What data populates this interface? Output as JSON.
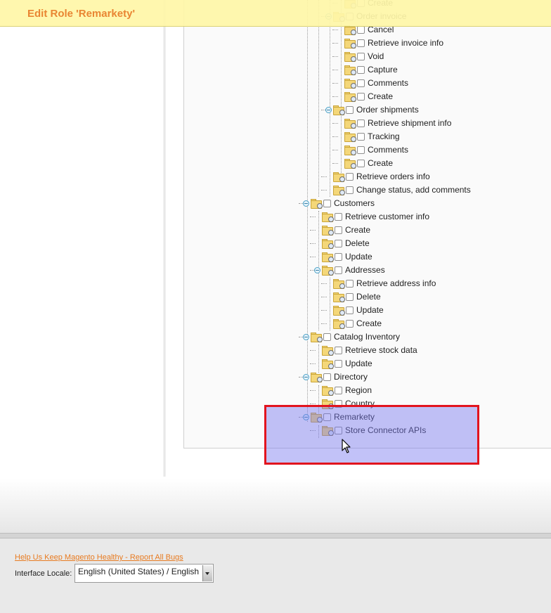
{
  "header": {
    "title": "Edit Role 'Remarkety'"
  },
  "tree": [
    {
      "label": "Create",
      "depth": 3,
      "toggle": false
    },
    {
      "label": "Order invoice",
      "depth": 2,
      "toggle": true
    },
    {
      "label": "Cancel",
      "depth": 3,
      "toggle": false
    },
    {
      "label": "Retrieve invoice info",
      "depth": 3,
      "toggle": false
    },
    {
      "label": "Void",
      "depth": 3,
      "toggle": false
    },
    {
      "label": "Capture",
      "depth": 3,
      "toggle": false
    },
    {
      "label": "Comments",
      "depth": 3,
      "toggle": false
    },
    {
      "label": "Create",
      "depth": 3,
      "toggle": false
    },
    {
      "label": "Order shipments",
      "depth": 2,
      "toggle": true
    },
    {
      "label": "Retrieve shipment info",
      "depth": 3,
      "toggle": false
    },
    {
      "label": "Tracking",
      "depth": 3,
      "toggle": false
    },
    {
      "label": "Comments",
      "depth": 3,
      "toggle": false
    },
    {
      "label": "Create",
      "depth": 3,
      "toggle": false
    },
    {
      "label": "Retrieve orders info",
      "depth": 2,
      "toggle": false
    },
    {
      "label": "Change status, add comments",
      "depth": 2,
      "toggle": false
    },
    {
      "label": "Customers",
      "depth": 0,
      "toggle": true
    },
    {
      "label": "Retrieve customer info",
      "depth": 1,
      "toggle": false
    },
    {
      "label": "Create",
      "depth": 1,
      "toggle": false
    },
    {
      "label": "Delete",
      "depth": 1,
      "toggle": false
    },
    {
      "label": "Update",
      "depth": 1,
      "toggle": false
    },
    {
      "label": "Addresses",
      "depth": 1,
      "toggle": true
    },
    {
      "label": "Retrieve address info",
      "depth": 2,
      "toggle": false
    },
    {
      "label": "Delete",
      "depth": 2,
      "toggle": false
    },
    {
      "label": "Update",
      "depth": 2,
      "toggle": false
    },
    {
      "label": "Create",
      "depth": 2,
      "toggle": false
    },
    {
      "label": "Catalog Inventory",
      "depth": 0,
      "toggle": true
    },
    {
      "label": "Retrieve stock data",
      "depth": 1,
      "toggle": false
    },
    {
      "label": "Update",
      "depth": 1,
      "toggle": false
    },
    {
      "label": "Directory",
      "depth": 0,
      "toggle": true
    },
    {
      "label": "Region",
      "depth": 1,
      "toggle": false
    },
    {
      "label": "Country",
      "depth": 1,
      "toggle": false
    },
    {
      "label": "Remarkety",
      "depth": 0,
      "toggle": true
    },
    {
      "label": "Store Connector APIs",
      "depth": 1,
      "toggle": false
    }
  ],
  "footer": {
    "bug_link": "Help Us Keep Magento Healthy - Report All Bugs",
    "locale_label": "Interface Locale:",
    "locale_value": "English (United States) / English"
  },
  "colors": {
    "accent": "#e87b21",
    "header_bg": "#fff7a8",
    "highlight_border": "#e2141e",
    "highlight_fill": "#7878f0"
  }
}
